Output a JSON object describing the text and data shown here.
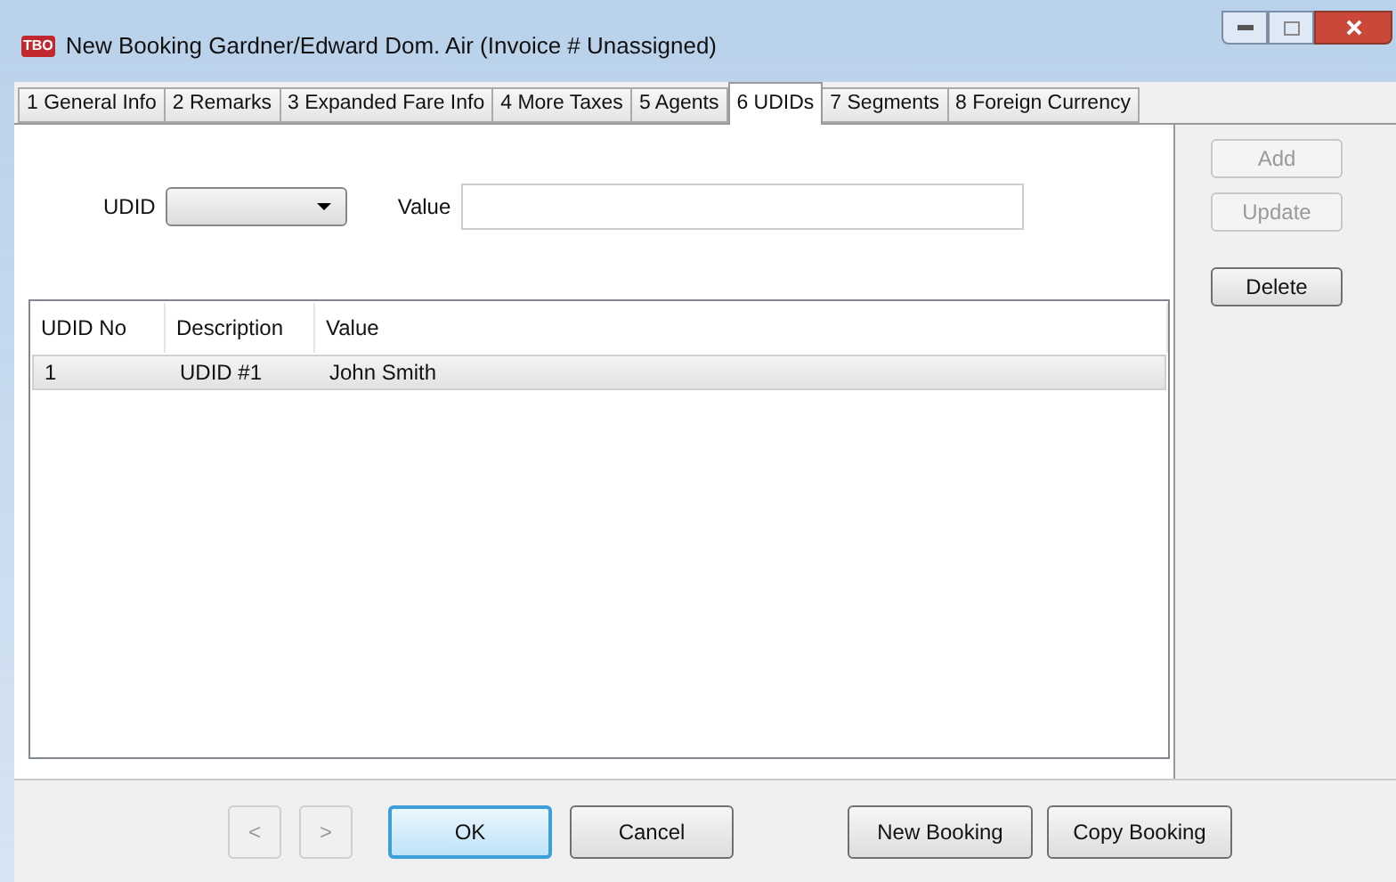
{
  "window": {
    "title": "New Booking Gardner/Edward Dom. Air (Invoice # Unassigned)",
    "app_icon": "TBO"
  },
  "tabs": [
    {
      "label": "1 General Info",
      "selected": false
    },
    {
      "label": "2 Remarks",
      "selected": false
    },
    {
      "label": "3 Expanded Fare Info",
      "selected": false
    },
    {
      "label": "4 More Taxes",
      "selected": false
    },
    {
      "label": "5 Agents",
      "selected": false
    },
    {
      "label": "6 UDIDs",
      "selected": true
    },
    {
      "label": "7 Segments",
      "selected": false
    },
    {
      "label": "8 Foreign Currency",
      "selected": false
    }
  ],
  "form": {
    "udid_label": "UDID",
    "value_label": "Value"
  },
  "table": {
    "columns": [
      "UDID No",
      "Description",
      "Value"
    ],
    "rows": [
      {
        "cells": [
          "1",
          "UDID #1",
          "John Smith"
        ],
        "selected": true
      }
    ]
  },
  "side_buttons": [
    {
      "label": "Add",
      "disabled": true
    },
    {
      "label": "Update",
      "disabled": true
    },
    {
      "label": "Delete",
      "disabled": false
    }
  ],
  "nav_buttons": [
    {
      "label": "<",
      "disabled": true
    },
    {
      "label": ">",
      "disabled": true
    }
  ],
  "footer_buttons": [
    {
      "label": "OK",
      "default": true
    },
    {
      "label": "Cancel",
      "default": false
    },
    {
      "label": "New Booking",
      "default": false
    },
    {
      "label": "Copy Booking",
      "default": false
    }
  ]
}
